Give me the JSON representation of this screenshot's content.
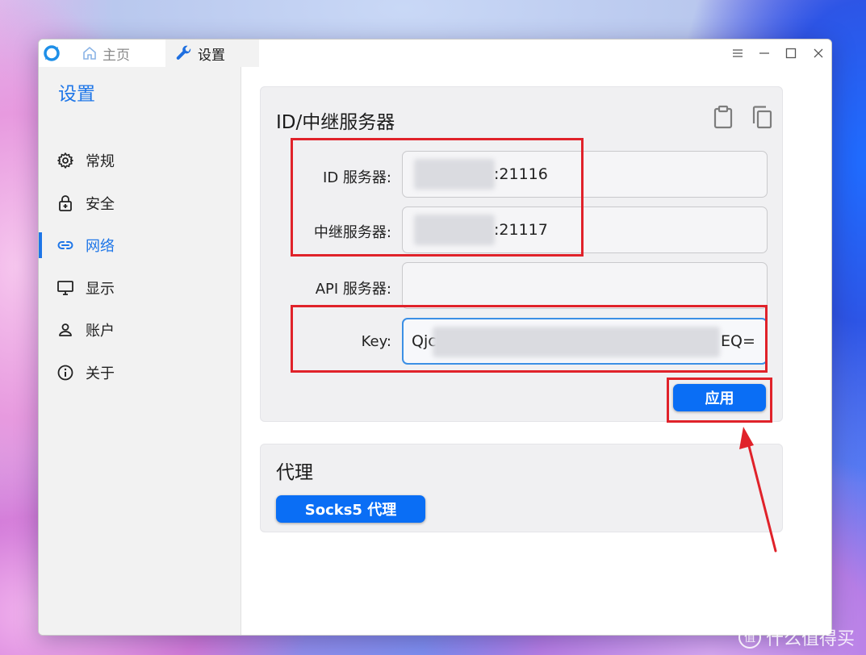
{
  "window": {
    "tabs": [
      {
        "label": "主页",
        "icon": "home-icon"
      },
      {
        "label": "设置",
        "icon": "wrench-icon"
      }
    ],
    "controls": [
      "menu-icon",
      "minimize-icon",
      "maximize-icon",
      "close-icon"
    ]
  },
  "sidebar": {
    "title": "设置",
    "items": [
      {
        "label": "常规",
        "icon": "gear-icon"
      },
      {
        "label": "安全",
        "icon": "lock-icon"
      },
      {
        "label": "网络",
        "icon": "link-icon",
        "active": true
      },
      {
        "label": "显示",
        "icon": "monitor-icon"
      },
      {
        "label": "账户",
        "icon": "user-icon"
      },
      {
        "label": "关于",
        "icon": "info-icon"
      }
    ]
  },
  "server_card": {
    "title": "ID/中继服务器",
    "icons": [
      "paste-icon",
      "copy-icon"
    ],
    "fields": {
      "id_server": {
        "label": "ID 服务器:",
        "value": ":21116"
      },
      "relay_server": {
        "label": "中继服务器:",
        "value": ":21117"
      },
      "api_server": {
        "label": "API 服务器:",
        "value": ""
      },
      "key": {
        "label": "Key:",
        "value_start": "Qjc",
        "value_end": "EQ="
      }
    },
    "apply_button": "应用"
  },
  "proxy_card": {
    "title": "代理",
    "socks_button": "Socks5 代理"
  },
  "watermark": {
    "logo_text": "值",
    "text": "什么值得买"
  },
  "colors": {
    "accent": "#1e76e8",
    "button": "#0a6ef5",
    "annotation_red": "#e0222a"
  }
}
